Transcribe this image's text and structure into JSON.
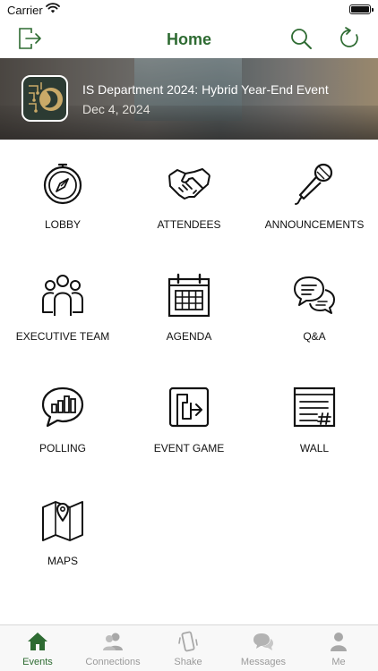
{
  "status_bar": {
    "carrier": "Carrier"
  },
  "nav": {
    "title": "Home"
  },
  "event": {
    "title": "IS Department 2024: Hybrid Year-End Event",
    "date": "Dec 4, 2024"
  },
  "tiles": [
    {
      "label": "LOBBY",
      "icon": "compass-icon"
    },
    {
      "label": "ATTENDEES",
      "icon": "handshake-icon"
    },
    {
      "label": "ANNOUNCEMENTS",
      "icon": "microphone-icon"
    },
    {
      "label": "EXECUTIVE TEAM",
      "icon": "people-group-icon"
    },
    {
      "label": "AGENDA",
      "icon": "calendar-icon"
    },
    {
      "label": "Q&A",
      "icon": "chat-bubbles-icon"
    },
    {
      "label": "POLLING",
      "icon": "poll-chart-bubble-icon"
    },
    {
      "label": "EVENT GAME",
      "icon": "game-icon"
    },
    {
      "label": "WALL",
      "icon": "wall-post-icon"
    },
    {
      "label": "MAPS",
      "icon": "map-pin-icon"
    }
  ],
  "tabbar": {
    "items": [
      {
        "label": "Events",
        "icon": "home-icon",
        "active": true
      },
      {
        "label": "Connections",
        "icon": "connections-icon",
        "active": false
      },
      {
        "label": "Shake",
        "icon": "shake-phone-icon",
        "active": false
      },
      {
        "label": "Messages",
        "icon": "messages-icon",
        "active": false
      },
      {
        "label": "Me",
        "icon": "person-icon",
        "active": false
      }
    ]
  },
  "colors": {
    "accent": "#2e6b32",
    "inactive_tab": "#9a9a9a",
    "icon_stroke": "#111111"
  }
}
